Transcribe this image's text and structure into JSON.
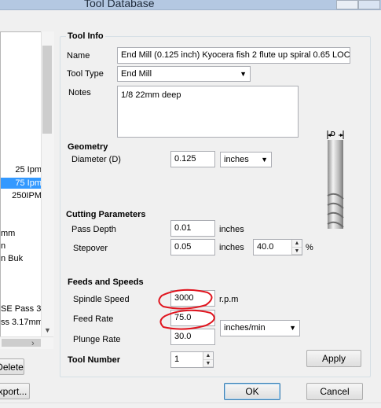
{
  "window": {
    "title": "Tool Database"
  },
  "tool_list": {
    "items": [
      {
        "label": "25 Ipm",
        "selected": false
      },
      {
        "label": "75 Ipm",
        "selected": true
      },
      {
        "label": "250IPM",
        "selected": false
      },
      {
        "label": "mm",
        "selected": false
      },
      {
        "label": "n",
        "selected": false
      },
      {
        "label": "n Buk",
        "selected": false
      },
      {
        "label": "SE  Pass 3.",
        "selected": false
      },
      {
        "label": "ss 3.17mm",
        "selected": false
      }
    ]
  },
  "buttons": {
    "delete": "Delete",
    "export": "xport...",
    "apply": "Apply",
    "ok": "OK",
    "cancel": "Cancel"
  },
  "tool_info": {
    "heading": "Tool Info",
    "name_label": "Name",
    "name_value": "End Mill (0.125 inch) Kyocera fish 2 flute up spiral  0.65 LOC",
    "type_label": "Tool Type",
    "type_value": "End Mill",
    "notes_label": "Notes",
    "notes_value": "1/8 22mm deep"
  },
  "geometry": {
    "heading": "Geometry",
    "diameter_label": "Diameter (D)",
    "diameter_value": "0.125",
    "units_value": "inches",
    "diagram_marker": "D"
  },
  "cutting": {
    "heading": "Cutting Parameters",
    "pass_depth_label": "Pass Depth",
    "pass_depth_value": "0.01",
    "pass_depth_unit": "inches",
    "stepover_label": "Stepover",
    "stepover_value": "0.05",
    "stepover_unit": "inches",
    "stepover_percent": "40.0",
    "percent_sign": "%"
  },
  "feeds": {
    "heading": "Feeds and Speeds",
    "spindle_label": "Spindle Speed",
    "spindle_value": "3000",
    "spindle_unit": "r.p.m",
    "feed_label": "Feed Rate",
    "feed_value": "75.0",
    "feed_units": "inches/min",
    "plunge_label": "Plunge Rate",
    "plunge_value": "30.0"
  },
  "tool_number": {
    "label": "Tool Number",
    "value": "1"
  },
  "annotation_color": "#e0141e",
  "icons": [
    "chevron-down-icon",
    "spin-up-icon",
    "spin-down-icon",
    "scroll-down-icon",
    "scroll-right-icon",
    "end-mill-diagram-icon"
  ]
}
